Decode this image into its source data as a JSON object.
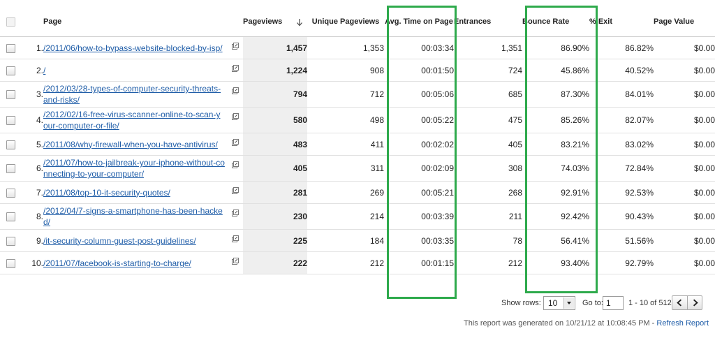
{
  "headers": {
    "page": "Page",
    "pageviews": "Pageviews",
    "unique_pageviews": "Unique Pageviews",
    "avg_time": "Avg. Time on Page",
    "entrances": "Entrances",
    "bounce_rate": "Bounce Rate",
    "exit": "% Exit",
    "page_value": "Page Value"
  },
  "rows": [
    {
      "idx": "1.",
      "page": "/2011/06/how-to-bypass-website-blocked-by-isp/",
      "pageviews": "1,457",
      "unique": "1,353",
      "avg_time": "00:03:34",
      "entrances": "1,351",
      "bounce": "86.90%",
      "exit": "86.82%",
      "value": "$0.00"
    },
    {
      "idx": "2.",
      "page": "/",
      "pageviews": "1,224",
      "unique": "908",
      "avg_time": "00:01:50",
      "entrances": "724",
      "bounce": "45.86%",
      "exit": "40.52%",
      "value": "$0.00"
    },
    {
      "idx": "3.",
      "page": "/2012/03/28-types-of-computer-security-threats-and-risks/",
      "pageviews": "794",
      "unique": "712",
      "avg_time": "00:05:06",
      "entrances": "685",
      "bounce": "87.30%",
      "exit": "84.01%",
      "value": "$0.00"
    },
    {
      "idx": "4.",
      "page": "/2012/02/16-free-virus-scanner-online-to-scan-your-computer-or-file/",
      "pageviews": "580",
      "unique": "498",
      "avg_time": "00:05:22",
      "entrances": "475",
      "bounce": "85.26%",
      "exit": "82.07%",
      "value": "$0.00"
    },
    {
      "idx": "5.",
      "page": "/2011/08/why-firewall-when-you-have-antivirus/",
      "pageviews": "483",
      "unique": "411",
      "avg_time": "00:02:02",
      "entrances": "405",
      "bounce": "83.21%",
      "exit": "83.02%",
      "value": "$0.00"
    },
    {
      "idx": "6.",
      "page": "/2011/07/how-to-jailbreak-your-iphone-without-connecting-to-your-computer/",
      "pageviews": "405",
      "unique": "311",
      "avg_time": "00:02:09",
      "entrances": "308",
      "bounce": "74.03%",
      "exit": "72.84%",
      "value": "$0.00"
    },
    {
      "idx": "7.",
      "page": "/2011/08/top-10-it-security-quotes/",
      "pageviews": "281",
      "unique": "269",
      "avg_time": "00:05:21",
      "entrances": "268",
      "bounce": "92.91%",
      "exit": "92.53%",
      "value": "$0.00"
    },
    {
      "idx": "8.",
      "page": "/2012/04/7-signs-a-smartphone-has-been-hacked/",
      "pageviews": "230",
      "unique": "214",
      "avg_time": "00:03:39",
      "entrances": "211",
      "bounce": "92.42%",
      "exit": "90.43%",
      "value": "$0.00"
    },
    {
      "idx": "9.",
      "page": "/it-security-column-guest-post-guidelines/",
      "pageviews": "225",
      "unique": "184",
      "avg_time": "00:03:35",
      "entrances": "78",
      "bounce": "56.41%",
      "exit": "51.56%",
      "value": "$0.00"
    },
    {
      "idx": "10.",
      "page": "/2011/07/facebook-is-starting-to-charge/",
      "pageviews": "222",
      "unique": "212",
      "avg_time": "00:01:15",
      "entrances": "212",
      "bounce": "93.40%",
      "exit": "92.79%",
      "value": "$0.00"
    }
  ],
  "footer": {
    "show_rows_label": "Show rows:",
    "show_rows_value": "10",
    "goto_label": "Go to:",
    "goto_value": "1",
    "range": "1 - 10 of 512",
    "generated": "This report was generated on 10/21/12 at 10:08:45 PM - ",
    "refresh": "Refresh Report"
  },
  "colors": {
    "highlight": "#2eaa4c",
    "link": "#1f5da8"
  },
  "icons": {
    "sort": "sort-down-arrow-icon",
    "popout": "open-page-icon"
  }
}
